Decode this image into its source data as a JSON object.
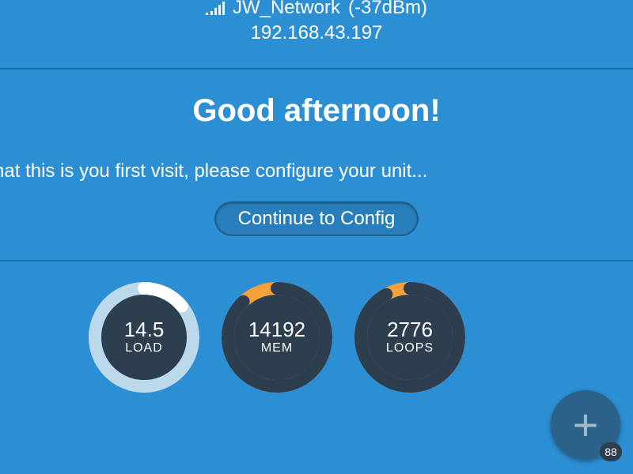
{
  "header": {
    "ssid": "JW_Network",
    "signal_dbm": "(-37dBm)",
    "ip": "192.168.43.197"
  },
  "greeting": "Good afternoon!",
  "first_visit_msg": "see that this is you first visit, please configure your unit...",
  "config_button": "Continue to Config",
  "gauges": {
    "load": {
      "value": "14.5",
      "label": "LOAD",
      "fraction": 0.14,
      "track": "#bcd9eb",
      "ring": "#ffffff"
    },
    "mem": {
      "value": "14192",
      "label": "MEM",
      "fraction": 0.88,
      "track": "#f7a13a",
      "ring": "#2d3e4f"
    },
    "loops": {
      "value": "2776",
      "label": "LOOPS",
      "fraction": 0.92,
      "track": "#f7a13a",
      "ring": "#2d3e4f"
    }
  },
  "fab": {
    "badge": "88"
  },
  "colors": {
    "bg": "#2c8fd3",
    "dark": "#2d3e4f",
    "accent": "#f7a13a"
  }
}
